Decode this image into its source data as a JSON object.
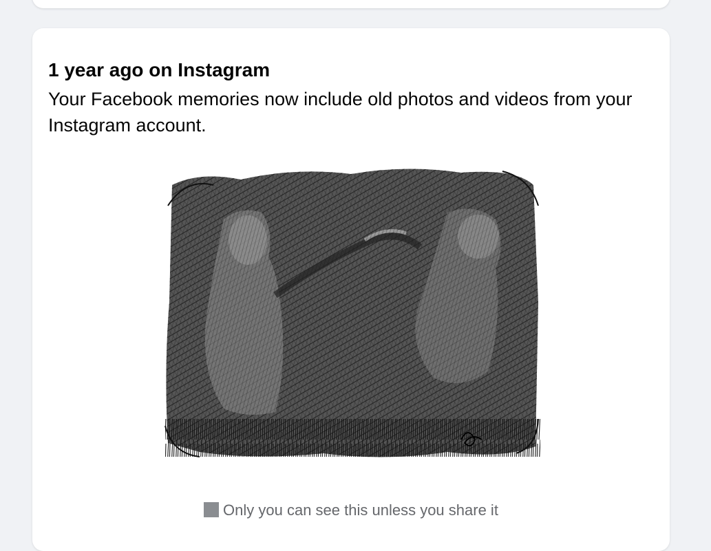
{
  "memory_card": {
    "title": "1 year ago on Instagram",
    "description": "Your Facebook memories now include old photos and videos from your Instagram account.",
    "photo_icon": "sketch-photo",
    "privacy_icon": "privacy-lock-icon",
    "privacy_text": "Only you can see this unless you share it"
  }
}
